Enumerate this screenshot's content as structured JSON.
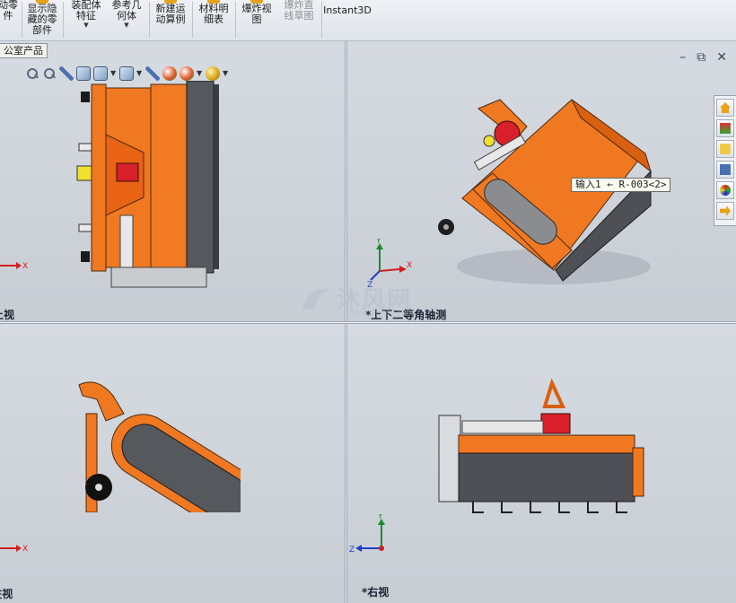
{
  "ribbon": {
    "items": [
      {
        "label": "动零\n件",
        "disabled": false
      },
      {
        "label": "显示隐\n藏的零\n部件",
        "disabled": false
      },
      {
        "label": "装配体\n特征",
        "disabled": false
      },
      {
        "label": "参考几\n何体",
        "disabled": false
      },
      {
        "label": "新建运\n动算例",
        "disabled": false
      },
      {
        "label": "材料明\n细表",
        "disabled": false
      },
      {
        "label": "爆炸视\n图",
        "disabled": false
      },
      {
        "label": "爆炸直\n线草图",
        "disabled": true
      },
      {
        "label": "Instant3D",
        "disabled": false
      }
    ]
  },
  "model_tab": "公室产品",
  "window_controls": [
    "–",
    "⧉",
    "✕"
  ],
  "viewports": {
    "top_left": {
      "label": "上视"
    },
    "top_right": {
      "label": "*上下二等角轴测",
      "tooltip": "输入1 ← R-003<2>"
    },
    "bottom_left": {
      "label": "*左视"
    },
    "bottom_right": {
      "label": "*右视"
    }
  },
  "triad_labels": {
    "x": "X",
    "y": "Y",
    "z": "Z"
  },
  "task_pane": [
    "home-icon",
    "resources-icon",
    "folder-icon",
    "view-palette-icon",
    "appearances-icon",
    "custom-properties-icon"
  ],
  "watermark": {
    "text": "沐风网",
    "url": "www.mfcad.com"
  },
  "colors": {
    "model_orange": "#f07820",
    "belt_gray": "#5a5d62",
    "background": "#cdd2d9"
  }
}
